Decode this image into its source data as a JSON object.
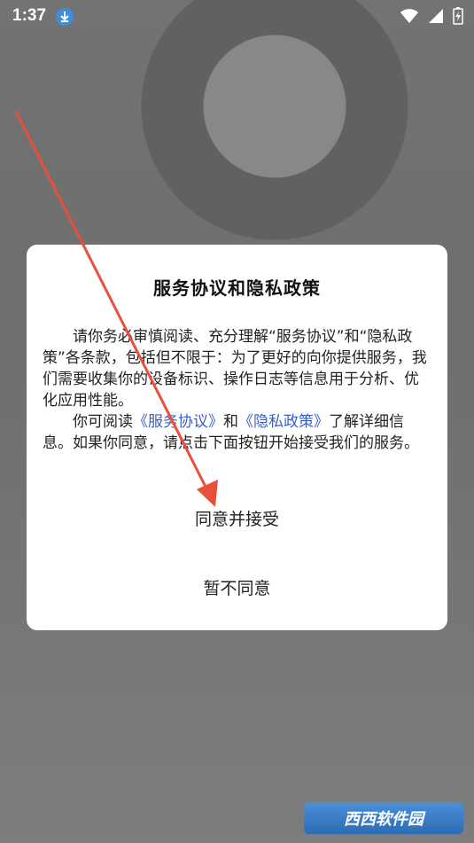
{
  "status": {
    "time": "1:37",
    "icons": [
      "download-icon",
      "wifi-icon",
      "signal-icon",
      "battery-charging-icon"
    ]
  },
  "dialog": {
    "title": "服务协议和隐私政策",
    "para1": "请你务必审慎阅读、充分理解“服务协议”和“隐私政策”各条款，包括但不限于：为了更好的向你提供服务，我们需要收集你的设备标识、操作日志等信息用于分析、优化应用性能。",
    "para2_prefix": "你可阅读",
    "link_service": "《服务协议》",
    "para2_and": "和",
    "link_privacy": "《隐私政策》",
    "para2_suffix": "了解详细信息。如果你同意，请点击下面按钮开始接受我们的服务。",
    "agree_label": "同意并接受",
    "decline_label": "暂不同意"
  },
  "watermark": {
    "text": "西西软件园"
  },
  "colors": {
    "link": "#3a5fcd",
    "arrow": "#e8503a",
    "overlay": "#7a7a7a"
  }
}
